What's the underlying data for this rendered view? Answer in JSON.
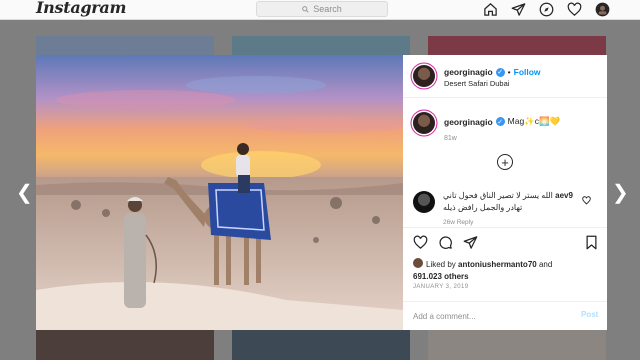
{
  "topbar": {
    "logo": "Instagram",
    "search_placeholder": "Search",
    "nav_icons": [
      "home-icon",
      "direct-icon",
      "explore-icon",
      "heart-icon",
      "profile-avatar"
    ]
  },
  "post": {
    "username": "georginagio",
    "follow_label": "Follow",
    "dot": "•",
    "location": "Desert Safari Dubai",
    "caption": {
      "username": "georginagio",
      "text": "Mag✨c🌅💛",
      "time": "81w"
    },
    "more_comments_icon": "plus-circle-icon",
    "comment": {
      "username": "aev9",
      "text": "الله يستر لا تصير الناق فحول تاني تهادر والجمل رافض ذيله",
      "meta": "26w  Reply"
    },
    "likes": {
      "prefix": "Liked by",
      "user": "antoniushermanto70",
      "joiner": "and",
      "count": "691.023 others"
    },
    "date": "JANUARY 3, 2019",
    "comment_placeholder": "Add a comment...",
    "post_label": "Post"
  },
  "colors": {
    "accent": "#0095f6",
    "verified": "#3897f0",
    "post_disabled": "#b2dffc",
    "backdrop": "#7f7f7f"
  }
}
